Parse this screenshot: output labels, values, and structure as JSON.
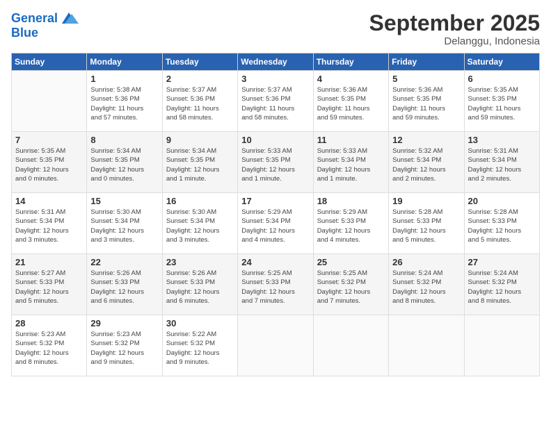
{
  "logo": {
    "general": "General",
    "blue": "Blue"
  },
  "header": {
    "month": "September 2025",
    "location": "Delanggu, Indonesia"
  },
  "days_of_week": [
    "Sunday",
    "Monday",
    "Tuesday",
    "Wednesday",
    "Thursday",
    "Friday",
    "Saturday"
  ],
  "weeks": [
    [
      {
        "day": "",
        "info": ""
      },
      {
        "day": "1",
        "info": "Sunrise: 5:38 AM\nSunset: 5:36 PM\nDaylight: 11 hours\nand 57 minutes."
      },
      {
        "day": "2",
        "info": "Sunrise: 5:37 AM\nSunset: 5:36 PM\nDaylight: 11 hours\nand 58 minutes."
      },
      {
        "day": "3",
        "info": "Sunrise: 5:37 AM\nSunset: 5:36 PM\nDaylight: 11 hours\nand 58 minutes."
      },
      {
        "day": "4",
        "info": "Sunrise: 5:36 AM\nSunset: 5:35 PM\nDaylight: 11 hours\nand 59 minutes."
      },
      {
        "day": "5",
        "info": "Sunrise: 5:36 AM\nSunset: 5:35 PM\nDaylight: 11 hours\nand 59 minutes."
      },
      {
        "day": "6",
        "info": "Sunrise: 5:35 AM\nSunset: 5:35 PM\nDaylight: 11 hours\nand 59 minutes."
      }
    ],
    [
      {
        "day": "7",
        "info": "Sunrise: 5:35 AM\nSunset: 5:35 PM\nDaylight: 12 hours\nand 0 minutes."
      },
      {
        "day": "8",
        "info": "Sunrise: 5:34 AM\nSunset: 5:35 PM\nDaylight: 12 hours\nand 0 minutes."
      },
      {
        "day": "9",
        "info": "Sunrise: 5:34 AM\nSunset: 5:35 PM\nDaylight: 12 hours\nand 1 minute."
      },
      {
        "day": "10",
        "info": "Sunrise: 5:33 AM\nSunset: 5:35 PM\nDaylight: 12 hours\nand 1 minute."
      },
      {
        "day": "11",
        "info": "Sunrise: 5:33 AM\nSunset: 5:34 PM\nDaylight: 12 hours\nand 1 minute."
      },
      {
        "day": "12",
        "info": "Sunrise: 5:32 AM\nSunset: 5:34 PM\nDaylight: 12 hours\nand 2 minutes."
      },
      {
        "day": "13",
        "info": "Sunrise: 5:31 AM\nSunset: 5:34 PM\nDaylight: 12 hours\nand 2 minutes."
      }
    ],
    [
      {
        "day": "14",
        "info": "Sunrise: 5:31 AM\nSunset: 5:34 PM\nDaylight: 12 hours\nand 3 minutes."
      },
      {
        "day": "15",
        "info": "Sunrise: 5:30 AM\nSunset: 5:34 PM\nDaylight: 12 hours\nand 3 minutes."
      },
      {
        "day": "16",
        "info": "Sunrise: 5:30 AM\nSunset: 5:34 PM\nDaylight: 12 hours\nand 3 minutes."
      },
      {
        "day": "17",
        "info": "Sunrise: 5:29 AM\nSunset: 5:34 PM\nDaylight: 12 hours\nand 4 minutes."
      },
      {
        "day": "18",
        "info": "Sunrise: 5:29 AM\nSunset: 5:33 PM\nDaylight: 12 hours\nand 4 minutes."
      },
      {
        "day": "19",
        "info": "Sunrise: 5:28 AM\nSunset: 5:33 PM\nDaylight: 12 hours\nand 5 minutes."
      },
      {
        "day": "20",
        "info": "Sunrise: 5:28 AM\nSunset: 5:33 PM\nDaylight: 12 hours\nand 5 minutes."
      }
    ],
    [
      {
        "day": "21",
        "info": "Sunrise: 5:27 AM\nSunset: 5:33 PM\nDaylight: 12 hours\nand 5 minutes."
      },
      {
        "day": "22",
        "info": "Sunrise: 5:26 AM\nSunset: 5:33 PM\nDaylight: 12 hours\nand 6 minutes."
      },
      {
        "day": "23",
        "info": "Sunrise: 5:26 AM\nSunset: 5:33 PM\nDaylight: 12 hours\nand 6 minutes."
      },
      {
        "day": "24",
        "info": "Sunrise: 5:25 AM\nSunset: 5:33 PM\nDaylight: 12 hours\nand 7 minutes."
      },
      {
        "day": "25",
        "info": "Sunrise: 5:25 AM\nSunset: 5:32 PM\nDaylight: 12 hours\nand 7 minutes."
      },
      {
        "day": "26",
        "info": "Sunrise: 5:24 AM\nSunset: 5:32 PM\nDaylight: 12 hours\nand 8 minutes."
      },
      {
        "day": "27",
        "info": "Sunrise: 5:24 AM\nSunset: 5:32 PM\nDaylight: 12 hours\nand 8 minutes."
      }
    ],
    [
      {
        "day": "28",
        "info": "Sunrise: 5:23 AM\nSunset: 5:32 PM\nDaylight: 12 hours\nand 8 minutes."
      },
      {
        "day": "29",
        "info": "Sunrise: 5:23 AM\nSunset: 5:32 PM\nDaylight: 12 hours\nand 9 minutes."
      },
      {
        "day": "30",
        "info": "Sunrise: 5:22 AM\nSunset: 5:32 PM\nDaylight: 12 hours\nand 9 minutes."
      },
      {
        "day": "",
        "info": ""
      },
      {
        "day": "",
        "info": ""
      },
      {
        "day": "",
        "info": ""
      },
      {
        "day": "",
        "info": ""
      }
    ]
  ]
}
